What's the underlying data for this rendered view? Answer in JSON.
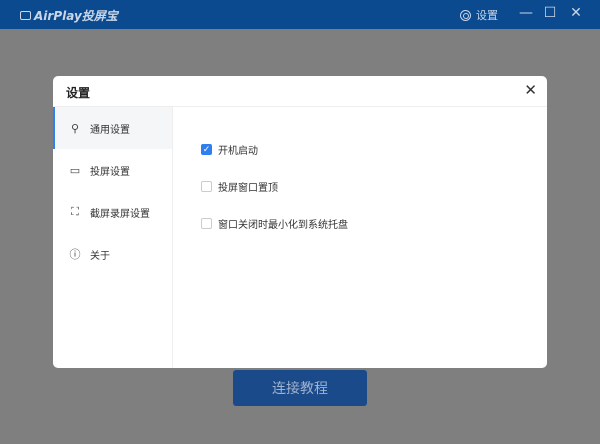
{
  "app": {
    "title": "AirPlay投屏宝",
    "settings_label": "设置",
    "minimize": "—",
    "maximize": "☐",
    "close": "✕"
  },
  "main_button": "连接教程",
  "dialog": {
    "title": "设置",
    "close": "✕",
    "sidebar": [
      {
        "icon": "wrench-icon",
        "glyph": "🔧",
        "label": "通用设置",
        "active": true
      },
      {
        "icon": "monitor-icon",
        "glyph": "▭",
        "label": "投屏设置"
      },
      {
        "icon": "screenshot-icon",
        "glyph": "⛶",
        "label": "截屏录屏设置"
      },
      {
        "icon": "info-icon",
        "glyph": "ⓘ",
        "label": "关于"
      }
    ],
    "options": [
      {
        "label": "开机启动",
        "checked": true
      },
      {
        "label": "投屏窗口置顶",
        "checked": false
      },
      {
        "label": "窗口关闭时最小化到系统托盘",
        "checked": false
      }
    ]
  }
}
